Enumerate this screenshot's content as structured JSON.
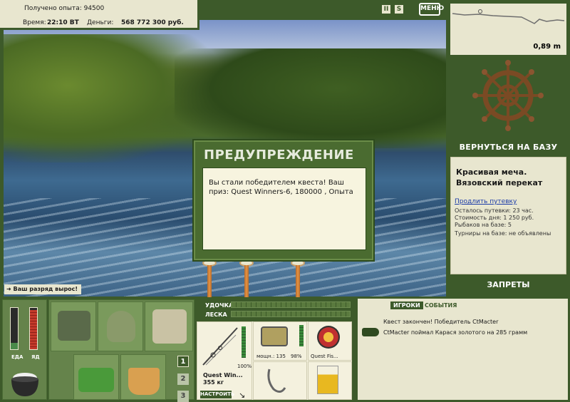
{
  "hud": {
    "experience": "Получено опыта: 94500",
    "time_label": "Время:",
    "time_value": "22:10 ВТ",
    "money_label": "Деньги:",
    "money_value": "568 772 300 руб."
  },
  "top_controls": {
    "pause_glyph": "II",
    "sound_glyph": "S",
    "menu_label": "МЕНЮ"
  },
  "depth_map": {
    "depth_value": "0,89 m"
  },
  "right": {
    "return_label": "ВЕРНУТЬСЯ НА БАЗУ",
    "location_title": "Красивая меча.\nВязовский перекат",
    "extend_link": "Продлить путевку",
    "lines": [
      "Осталось путевки: 23 час.",
      "Стоимость дня: 1 250 руб.",
      "Рыбаков на базе: 5",
      "Турниры на базе: не объявлены"
    ],
    "bans_label": "ЗАПРЕТЫ"
  },
  "dialog": {
    "title": "ПРЕДУПРЕЖДЕНИЕ",
    "body": "Вы стали победителем квеста! Ваш приз: Quest Winners-6, 180000 , Опыта"
  },
  "rank_notice": "Ваш разряд вырос!",
  "needs": {
    "food_label": "ЕДА",
    "poison_label": "ЯД",
    "food_level": 0.15,
    "poison_level": 0.95
  },
  "inventory_pages": [
    "1",
    "2",
    "3"
  ],
  "gauges": {
    "rod_label": "УДОЧКА",
    "line_label": "ЛЕСКА"
  },
  "rod": {
    "name": "Quest Win...",
    "weight": "355 кг",
    "durability": "100%",
    "setup_button": "НАСТРОИТЬ",
    "reel_power": "мощн.: 135",
    "reel_percent": "98%",
    "line_name": "Quest Fis...",
    "hook_text": "",
    "bait_text": ""
  },
  "events": {
    "tab_players": "ИГРОКИ",
    "tab_events": "СОБЫТИЯ",
    "messages": [
      "Квест закончен! Победитель CtMacter",
      "CtMacter поймал Карася золотого на 285 грамм"
    ]
  },
  "colors": {
    "frame_green": "#3d5a2a",
    "panel_cream": "#e8e6cf",
    "dialog_green": "#4a6b30"
  }
}
